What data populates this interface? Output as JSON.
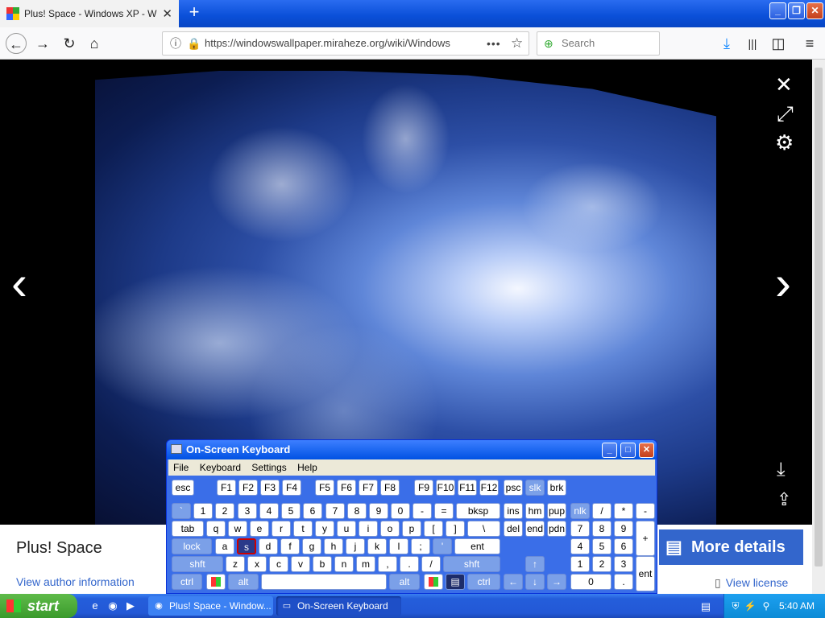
{
  "browser": {
    "tab_title": "Plus! Space - Windows XP - Windo",
    "tab_close": "✕",
    "new_tab": "+",
    "url": "https://windowswallpaper.miraheze.org/wiki/Windows",
    "search_placeholder": "Search",
    "back": "←",
    "forward": "→",
    "reload": "↻",
    "home": "⌂",
    "page_actions": "•••",
    "bookmark": "☆",
    "download": "⤓",
    "library": "|||",
    "sidebar": "◫",
    "menu": "≡",
    "win_min": "_",
    "win_restore": "❐",
    "win_close": "✕"
  },
  "viewer": {
    "close": "✕",
    "expand": "⤢",
    "settings": "⚙",
    "prev": "‹",
    "next": "›",
    "download": "⤓",
    "share": "⇪"
  },
  "info": {
    "title": "Plus! Space",
    "author_link": "View author information",
    "more_details": "More details",
    "view_license": "View license"
  },
  "osk": {
    "title": "On-Screen Keyboard",
    "menu": [
      "File",
      "Keyboard",
      "Settings",
      "Help"
    ],
    "btn_min": "_",
    "btn_max": "□",
    "btn_close": "✕",
    "keys": {
      "esc": "esc",
      "f1": "F1",
      "f2": "F2",
      "f3": "F3",
      "f4": "F4",
      "f5": "F5",
      "f6": "F6",
      "f7": "F7",
      "f8": "F8",
      "f9": "F9",
      "f10": "F10",
      "f11": "F11",
      "f12": "F12",
      "psc": "psc",
      "slk": "slk",
      "brk": "brk",
      "grave": "`",
      "n1": "1",
      "n2": "2",
      "n3": "3",
      "n4": "4",
      "n5": "5",
      "n6": "6",
      "n7": "7",
      "n8": "8",
      "n9": "9",
      "n0": "0",
      "minus": "-",
      "equals": "=",
      "bksp": "bksp",
      "ins": "ins",
      "hm": "hm",
      "pup": "pup",
      "nlk": "nlk",
      "kdiv": "/",
      "kmul": "*",
      "ksub": "-",
      "tab": "tab",
      "q": "q",
      "w": "w",
      "e": "e",
      "r": "r",
      "t": "t",
      "y": "y",
      "u": "u",
      "i": "i",
      "o": "o",
      "p": "p",
      "lbr": "[",
      "rbr": "]",
      "bsl": "\\",
      "del": "del",
      "end": "end",
      "pdn": "pdn",
      "k7": "7",
      "k8": "8",
      "k9": "9",
      "kadd": "+",
      "lock": "lock",
      "a": "a",
      "s": "s",
      "d": "d",
      "f": "f",
      "g": "g",
      "h": "h",
      "j": "j",
      "k": "k",
      "l": "l",
      "semi": ";",
      "quote": "'",
      "ent": "ent",
      "k4": "4",
      "k5": "5",
      "k6": "6",
      "shft": "shft",
      "z": "z",
      "x": "x",
      "c": "c",
      "v": "v",
      "b": "b",
      "n": "n",
      "m": "m",
      "comma": ",",
      "period": ".",
      "slash": "/",
      "rshft": "shft",
      "up": "↑",
      "k1": "1",
      "k2": "2",
      "k3": "3",
      "kent": "ent",
      "ctrl": "ctrl",
      "alt": "alt",
      "space": "",
      "ralt": "alt",
      "rctrl": "ctrl",
      "left": "←",
      "down": "↓",
      "right": "→",
      "k0": "0",
      "kdot": "."
    }
  },
  "taskbar": {
    "start": "start",
    "tasks": [
      "Plus! Space - Window...",
      "On-Screen Keyboard"
    ],
    "clock": "5:40 AM"
  }
}
